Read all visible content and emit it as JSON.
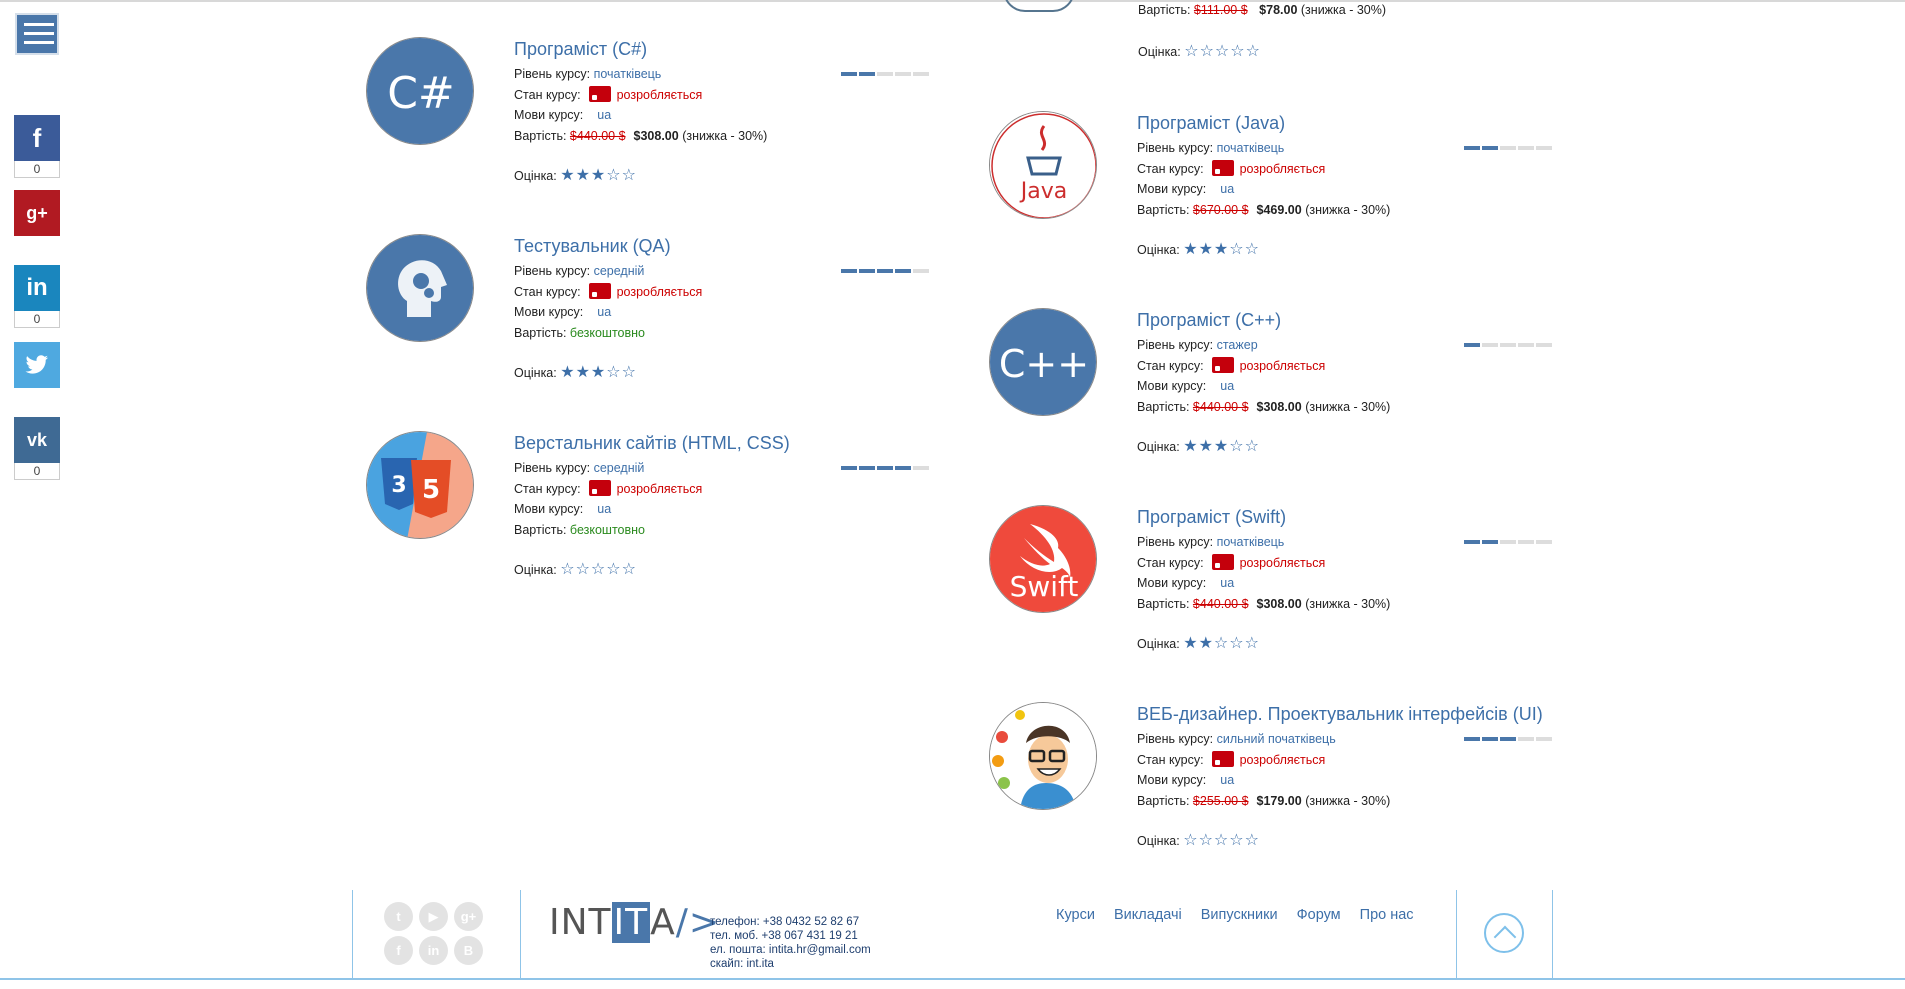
{
  "social": {
    "facebook_count": "0",
    "linkedin_count": "0",
    "vk_count": "0"
  },
  "labels": {
    "level": "Рівень курсу:",
    "status": "Стан курсу:",
    "langs": "Мови курсу:",
    "price": "Вартість:",
    "rating": "Оцінка:"
  },
  "top_partial": {
    "old_price": "$111.00 $",
    "new_price": "$78.00",
    "discount": "(знижка - 30%)",
    "rating_label": "Оцінка:"
  },
  "courses_left": [
    {
      "title": "Програміст (C#)",
      "level": "початківець",
      "status": "розробляється",
      "lang": "ua",
      "old_price": "$440.00 $",
      "new_price": "$308.00",
      "discount": "(знижка - 30%)",
      "free": "",
      "stars": 3,
      "level_bars": 2,
      "logo": "csharp-logo"
    },
    {
      "title": "Тестувальник (QA)",
      "level": "середній",
      "status": "розробляється",
      "lang": "ua",
      "old_price": "",
      "new_price": "",
      "discount": "",
      "free": "безкоштовно",
      "stars": 3,
      "level_bars": 4,
      "logo": "qa-logo"
    },
    {
      "title": "Верстальник сайтів (HTML, CSS)",
      "level": "середній",
      "status": "розробляється",
      "lang": "ua",
      "old_price": "",
      "new_price": "",
      "discount": "",
      "free": "безкоштовно",
      "stars": 0,
      "level_bars": 4,
      "logo": "html-css-logo"
    }
  ],
  "courses_right": [
    {
      "title": "Програміст (Java)",
      "level": "початківець",
      "status": "розробляється",
      "lang": "ua",
      "old_price": "$670.00 $",
      "new_price": "$469.00",
      "discount": "(знижка - 30%)",
      "free": "",
      "stars": 3,
      "level_bars": 2,
      "logo": "java-logo"
    },
    {
      "title": "Програміст (C++)",
      "level": "стажер",
      "status": "розробляється",
      "lang": "ua",
      "old_price": "$440.00 $",
      "new_price": "$308.00",
      "discount": "(знижка - 30%)",
      "free": "",
      "stars": 3,
      "level_bars": 1,
      "logo": "cpp-logo"
    },
    {
      "title": "Програміст (Swift)",
      "level": "початківець",
      "status": "розробляється",
      "lang": "ua",
      "old_price": "$440.00 $",
      "new_price": "$308.00",
      "discount": "(знижка - 30%)",
      "free": "",
      "stars": 2,
      "level_bars": 2,
      "logo": "swift-logo"
    },
    {
      "title": "ВЕБ-дизайнер. Проектувальник інтерфейсів (UI)",
      "level": "сильний початківець",
      "status": "розробляється",
      "lang": "ua",
      "old_price": "$255.00 $",
      "new_price": "$179.00",
      "discount": "(знижка - 30%)",
      "free": "",
      "stars": 0,
      "level_bars": 3,
      "logo": "ui-designer-logo"
    }
  ],
  "footer": {
    "brand_a": "INT",
    "brand_b": "IT",
    "brand_c": "A",
    "brand_slash": "/>",
    "phone": "телефон: +38 0432 52 82 67",
    "mobile": "тел. моб. +38 067 431 19 21",
    "email": "ел. пошта: intita.hr@gmail.com",
    "skype": "скайп: int.ita",
    "nav": [
      "Курси",
      "Викладачі",
      "Випускники",
      "Форум",
      "Про нас"
    ]
  },
  "colors": {
    "accent": "#4a77aa",
    "danger": "#cc0000",
    "free": "#2a8a1e"
  }
}
